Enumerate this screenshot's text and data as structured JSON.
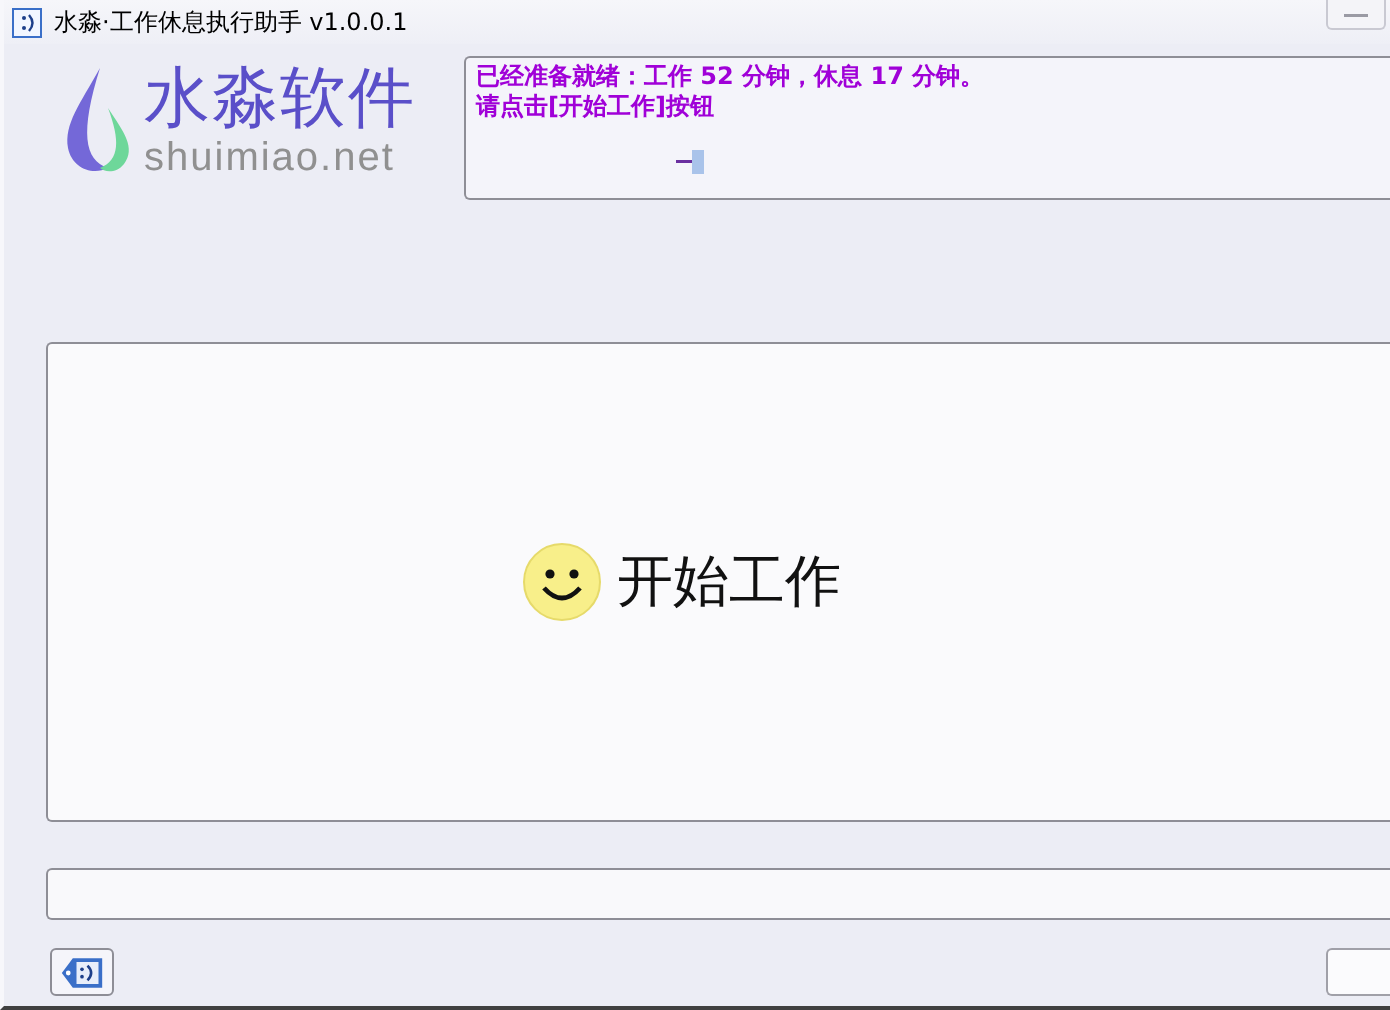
{
  "window": {
    "title": "水淼·工作休息执行助手 v1.0.0.1"
  },
  "logo": {
    "name": "水淼软件",
    "site": "shuimiao.net"
  },
  "message": {
    "lines": [
      "已经准备就绪：工作 52 分钟，休息 17 分钟。",
      "请点击[开始工作]按钮"
    ]
  },
  "start_button": {
    "label": "开始工作"
  }
}
